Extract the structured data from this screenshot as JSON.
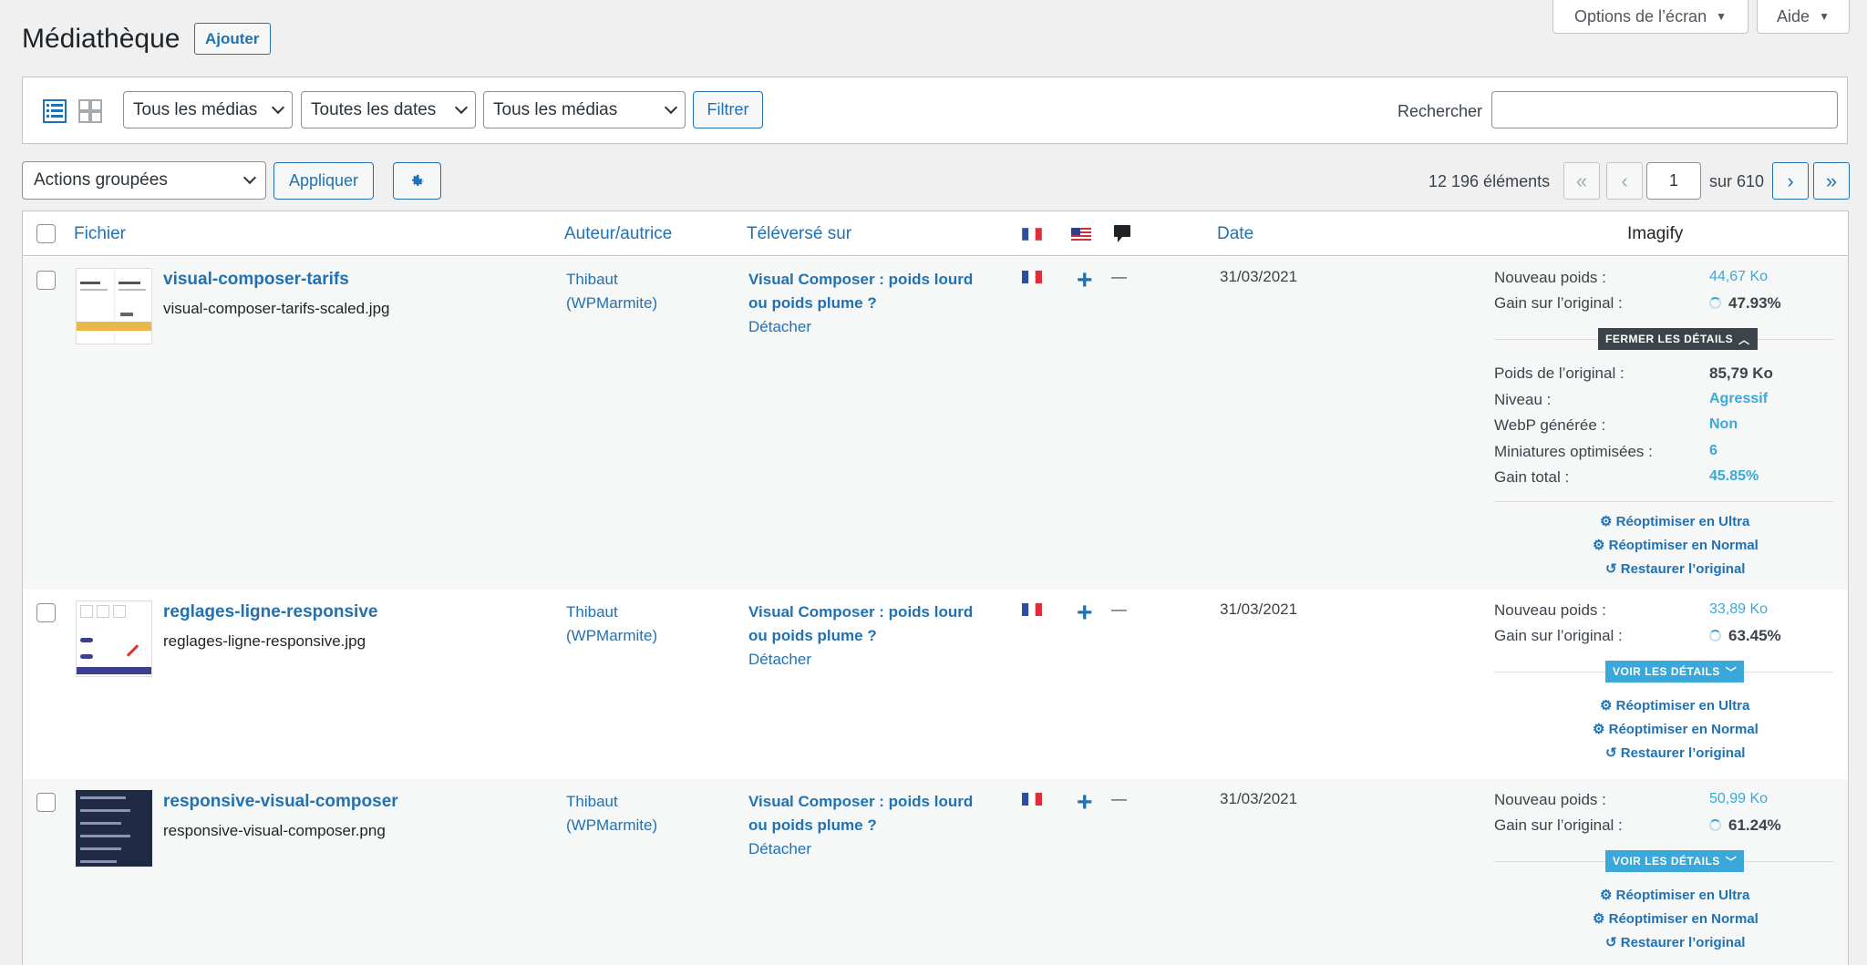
{
  "header": {
    "title": "Médiathèque",
    "add_label": "Ajouter",
    "screen_options_label": "Options de l’écran",
    "help_label": "Aide"
  },
  "filters": {
    "type_select": "Tous les médias",
    "date_select": "Toutes les dates",
    "media_select": "Tous les médias",
    "filter_label": "Filtrer",
    "search_label": "Rechercher",
    "search_value": ""
  },
  "bulk": {
    "actions_select": "Actions groupées",
    "apply_label": "Appliquer"
  },
  "pagination": {
    "count": "12 196 éléments",
    "first": "«",
    "prev": "‹",
    "current": "1",
    "total": "sur 610",
    "next": "›",
    "last": "»"
  },
  "columns": {
    "file": "Fichier",
    "author": "Auteur/autrice",
    "uploaded": "Téléversé sur",
    "date": "Date",
    "imagify": "Imagify"
  },
  "rows": [
    {
      "title": "visual-composer-tarifs",
      "file": "visual-composer-tarifs-scaled.jpg",
      "author_line1": "Thibaut",
      "author_line2": "(WPMarmite)",
      "uploaded_line1": "Visual Composer : poids lourd",
      "uploaded_line2": "ou poids plume ?",
      "detach": "Détacher",
      "plus": "+",
      "dash": "—",
      "date": "31/03/2021",
      "new_weight_label": "Nouveau poids :",
      "new_weight": "44,67 Ko",
      "gain_label": "Gain sur l’original :",
      "gain": "47.93%",
      "details_btn": "FERMER LES DÉTAILS",
      "original_label": "Poids de l’original :",
      "original": "85,79 Ko",
      "level_label": "Niveau :",
      "level": "Agressif",
      "webp_label": "WebP générée :",
      "webp": "Non",
      "thumbs_label": "Miniatures optimisées :",
      "thumbs": "6",
      "total_label": "Gain total :",
      "total": "45.85%",
      "reopt_ultra": "Réoptimiser en Ultra",
      "reopt_normal": "Réoptimiser en Normal",
      "restore": "Restaurer l’original"
    },
    {
      "title": "reglages-ligne-responsive",
      "file": "reglages-ligne-responsive.jpg",
      "author_line1": "Thibaut",
      "author_line2": "(WPMarmite)",
      "uploaded_line1": "Visual Composer : poids lourd",
      "uploaded_line2": "ou poids plume ?",
      "detach": "Détacher",
      "plus": "+",
      "dash": "—",
      "date": "31/03/2021",
      "new_weight_label": "Nouveau poids :",
      "new_weight": "33,89 Ko",
      "gain_label": "Gain sur l’original :",
      "gain": "63.45%",
      "details_btn": "VOIR LES DÉTAILS",
      "reopt_ultra": "Réoptimiser en Ultra",
      "reopt_normal": "Réoptimiser en Normal",
      "restore": "Restaurer l’original"
    },
    {
      "title": "responsive-visual-composer",
      "file": "responsive-visual-composer.png",
      "author_line1": "Thibaut",
      "author_line2": "(WPMarmite)",
      "uploaded_line1": "Visual Composer : poids lourd",
      "uploaded_line2": "ou poids plume ?",
      "detach": "Détacher",
      "plus": "+",
      "dash": "—",
      "date": "31/03/2021",
      "new_weight_label": "Nouveau poids :",
      "new_weight": "50,99 Ko",
      "gain_label": "Gain sur l’original :",
      "gain": "61.24%",
      "details_btn": "VOIR LES DÉTAILS",
      "reopt_ultra": "Réoptimiser en Ultra",
      "reopt_normal": "Réoptimiser en Normal",
      "restore": "Restaurer l’original"
    }
  ],
  "icons": {
    "list_view": "list-view-icon",
    "grid_view": "grid-view-icon",
    "gear": "gear-icon",
    "comment": "comment-bubble-icon",
    "flag_fr": "flag-fr-icon",
    "flag_us": "flag-us-icon"
  },
  "colors": {
    "link": "#2271b1",
    "imagify_accent": "#3aa8d9",
    "dark_button": "#3c434a"
  }
}
